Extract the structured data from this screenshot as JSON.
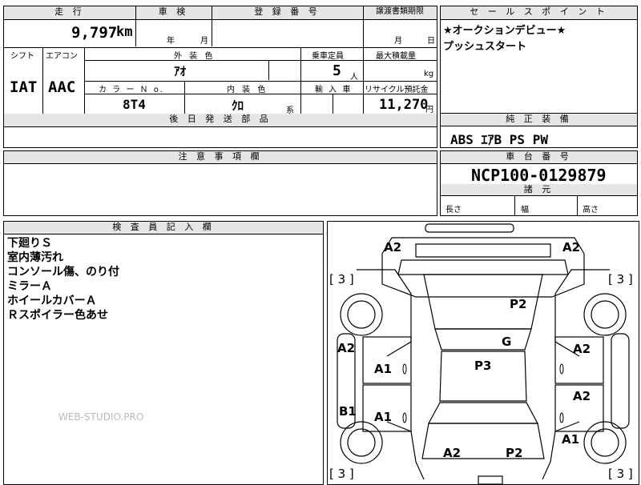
{
  "top_left": {
    "mileage_label": "走 行",
    "mileage_value": "9,797",
    "mileage_unit": "km",
    "inspection_label": "車 検",
    "inspection_year": "年",
    "inspection_month": "月",
    "registration_label": "登 録 番 号",
    "transfer_label": "譲渡書類期限",
    "transfer_month": "月",
    "transfer_day": "日",
    "shift_label": "シフト",
    "shift_value": "IAT",
    "aircon_label": "エアコン",
    "aircon_value": "AAC",
    "exterior_label": "外 装 色",
    "exterior_value": "ｱｵ",
    "capacity_label": "乗車定員",
    "capacity_value": "5",
    "capacity_unit": "人",
    "max_load_label": "最大積載量",
    "max_load_unit": "kg",
    "color_no_label": "カ ラ ー Ｎ o.",
    "color_no_value": "8T4",
    "interior_label": "内 装 色",
    "interior_value": "ｸﾛ",
    "interior_unit": "系",
    "import_label": "輸 入 車",
    "recycle_label": "リサイクル預託金",
    "recycle_value": "11,270",
    "recycle_unit": "円",
    "later_parts_label": "後 日 発 送 部 品"
  },
  "sales_point": {
    "title": "セ ー ル ス ポ イ ン ト",
    "lines": [
      "★オークションデビュー★",
      "プッシュスタート"
    ]
  },
  "equipment": {
    "title": "純 正 装 備",
    "value": "ABS ｴｱB PS PW"
  },
  "notes_section": {
    "title": "注 意 事 項 欄"
  },
  "chassis": {
    "title": "車 台 番 号",
    "value": "NCP100-0129879",
    "specs_title": "諸 元",
    "length_label": "長さ",
    "width_label": "幅",
    "height_label": "高さ"
  },
  "inspector": {
    "title": "検 査 員 記 入 欄",
    "lines": [
      "下廻りＳ",
      "室内薄汚れ",
      "コンソール傷、のり付",
      "ミラーＡ",
      "ホイールカバーＡ",
      "Ｒスポイラー色あせ"
    ],
    "watermark": "WEB-STUDIO.PRO"
  },
  "diagram": {
    "tl_a2": "A2",
    "tr_a2": "A2",
    "bracket_tl": "[ 3 ]",
    "bracket_tr": "[ 3 ]",
    "bracket_bl": "[ 3 ]",
    "bracket_br": "[ 3 ]",
    "p2_top": "P2",
    "g": "G",
    "p3": "P3",
    "left_a2": "A2",
    "left_b1": "B1",
    "a1_upper": "A1",
    "a1_lower": "A1",
    "right_a2_upper": "A2",
    "right_a2_lower": "A2",
    "right_a1": "A1",
    "bottom_a2": "A2",
    "bottom_p2": "P2"
  }
}
